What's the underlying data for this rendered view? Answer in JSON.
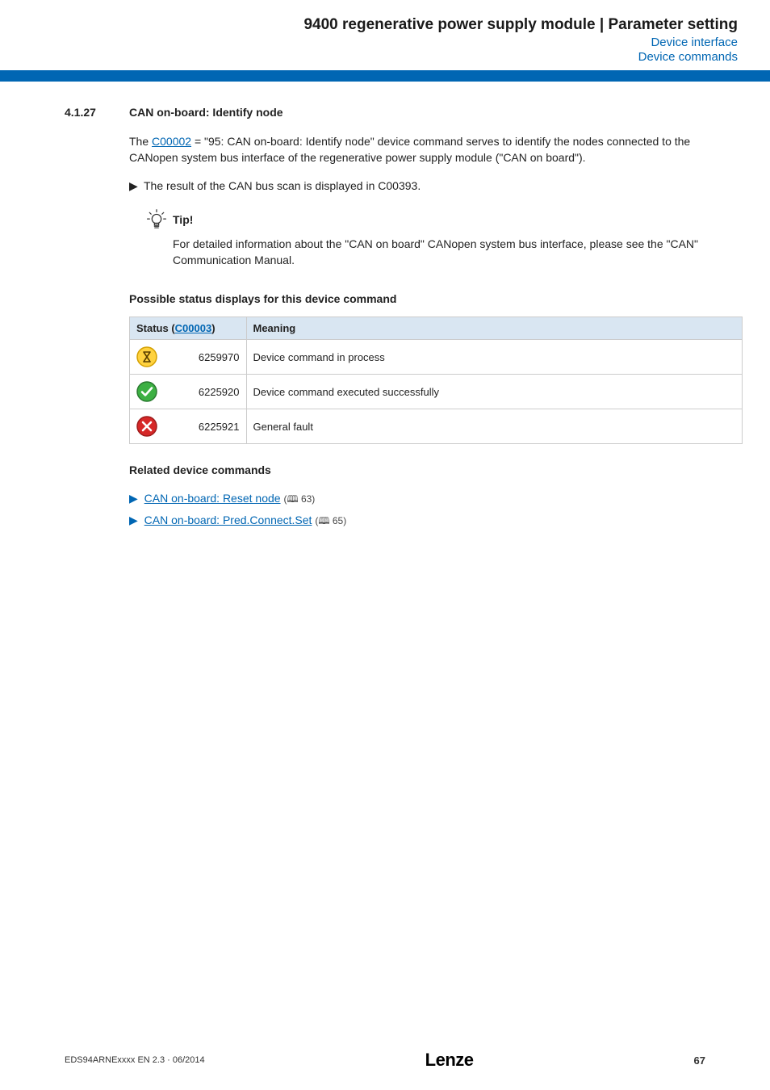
{
  "header": {
    "title": "9400 regenerative power supply module | Parameter setting",
    "sub1": "Device interface",
    "sub2": "Device commands"
  },
  "section": {
    "number": "4.1.27",
    "title": "CAN on-board: Identify node"
  },
  "para1_pre": "The ",
  "para1_link": "C00002",
  "para1_post": " = \"95: CAN on-board: Identify node\" device command serves to identify the nodes connected to the CANopen system bus interface of the regenerative power supply module (\"CAN on board\").",
  "bullet_pre": "The result of the CAN bus scan is displayed in ",
  "bullet_link": "C00393",
  "bullet_post": ".",
  "tip": {
    "label": "Tip!",
    "text": "For detailed information about the \"CAN on board\" CANopen system bus interface, please see the \"CAN\" Communication Manual."
  },
  "status_heading": "Possible status displays for this device command",
  "table": {
    "head_status_pre": "Status (",
    "head_status_link": "C00003",
    "head_status_post": ")",
    "head_meaning": "Meaning",
    "rows": [
      {
        "icon": "hourglass",
        "code": "6259970",
        "meaning": "Device command in process"
      },
      {
        "icon": "check",
        "code": "6225920",
        "meaning": "Device command executed successfully"
      },
      {
        "icon": "cross",
        "code": "6225921",
        "meaning": "General fault"
      }
    ]
  },
  "related": {
    "heading": "Related device commands",
    "items": [
      {
        "label": "CAN on-board: Reset node",
        "page": "63"
      },
      {
        "label": "CAN on-board: Pred.Connect.Set",
        "page": "65"
      }
    ]
  },
  "footer": {
    "left": "EDS94ARNExxxx EN 2.3 · 06/2014",
    "logo": "Lenze",
    "page": "67"
  }
}
